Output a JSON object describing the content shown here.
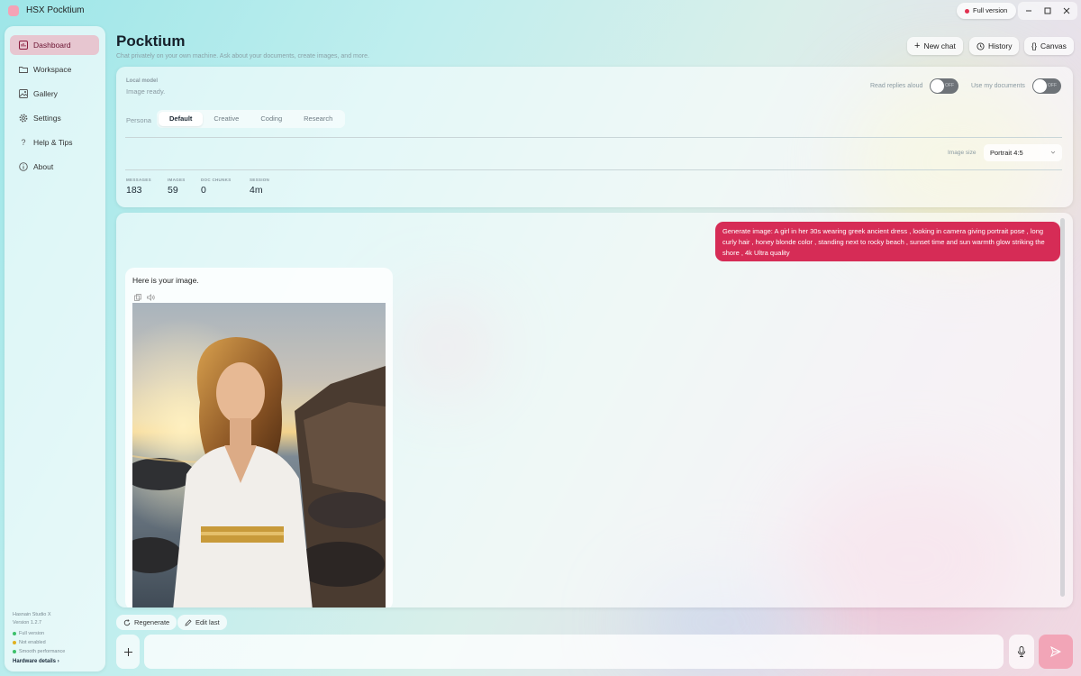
{
  "app": {
    "title": "HSX Pocktium",
    "full_version_label": "Full version"
  },
  "sidebar": {
    "items": [
      {
        "label": "Dashboard",
        "icon": "dashboard-icon",
        "active": true
      },
      {
        "label": "Workspace",
        "icon": "folder-icon"
      },
      {
        "label": "Gallery",
        "icon": "image-icon"
      },
      {
        "label": "Settings",
        "icon": "gear-icon"
      },
      {
        "label": "Help & Tips",
        "icon": "question-icon"
      },
      {
        "label": "About",
        "icon": "info-icon"
      }
    ],
    "footer": {
      "studio": "Hasnain Studio X",
      "version": "Version 1.2.7",
      "status_items": [
        {
          "label": "Full version",
          "color": "#3cc06a"
        },
        {
          "label": "Not enabled",
          "color": "#e0b020"
        },
        {
          "label": "Smooth performance",
          "color": "#3cc06a"
        }
      ],
      "hardware_link": "Hardware details ›"
    }
  },
  "header": {
    "title": "Pocktium",
    "subtitle": "Chat privately on your own machine. Ask about your documents, create images, and more.",
    "buttons": {
      "new_chat": "New chat",
      "history": "History",
      "canvas": "Canvas"
    }
  },
  "settings_panel": {
    "model_label": "Local model",
    "model_status": "Image ready.",
    "read_replies_label": "Read replies aloud",
    "use_docs_label": "Use my documents",
    "toggle_off_text": "OFF",
    "persona_label": "Persona",
    "persona_tabs": [
      "Default",
      "Creative",
      "Coding",
      "Research"
    ],
    "active_persona": "Default",
    "image_size_label": "Image size",
    "image_size_value": "Portrait 4:5",
    "stats": [
      {
        "label": "MESSAGES",
        "value": "183"
      },
      {
        "label": "IMAGES",
        "value": "59"
      },
      {
        "label": "DOC CHUNKS",
        "value": "0"
      },
      {
        "label": "SESSION",
        "value": "4m"
      }
    ]
  },
  "chat": {
    "user_message": "Generate image: A girl in her 30s wearing greek ancient dress , looking in camera giving portrait pose , long curly hair , honey blonde color , standing next to rocky beach , sunset time and sun warmth glow striking the shore , 4k Ultra quality",
    "bot_message": "Here is your image."
  },
  "actions": {
    "regenerate": "Regenerate",
    "edit_last": "Edit last"
  },
  "composer": {
    "placeholder": ""
  },
  "colors": {
    "accent": "#d62c56",
    "active_nav_bg": "#e7c6d0",
    "send_button": "#f2a5b7"
  }
}
